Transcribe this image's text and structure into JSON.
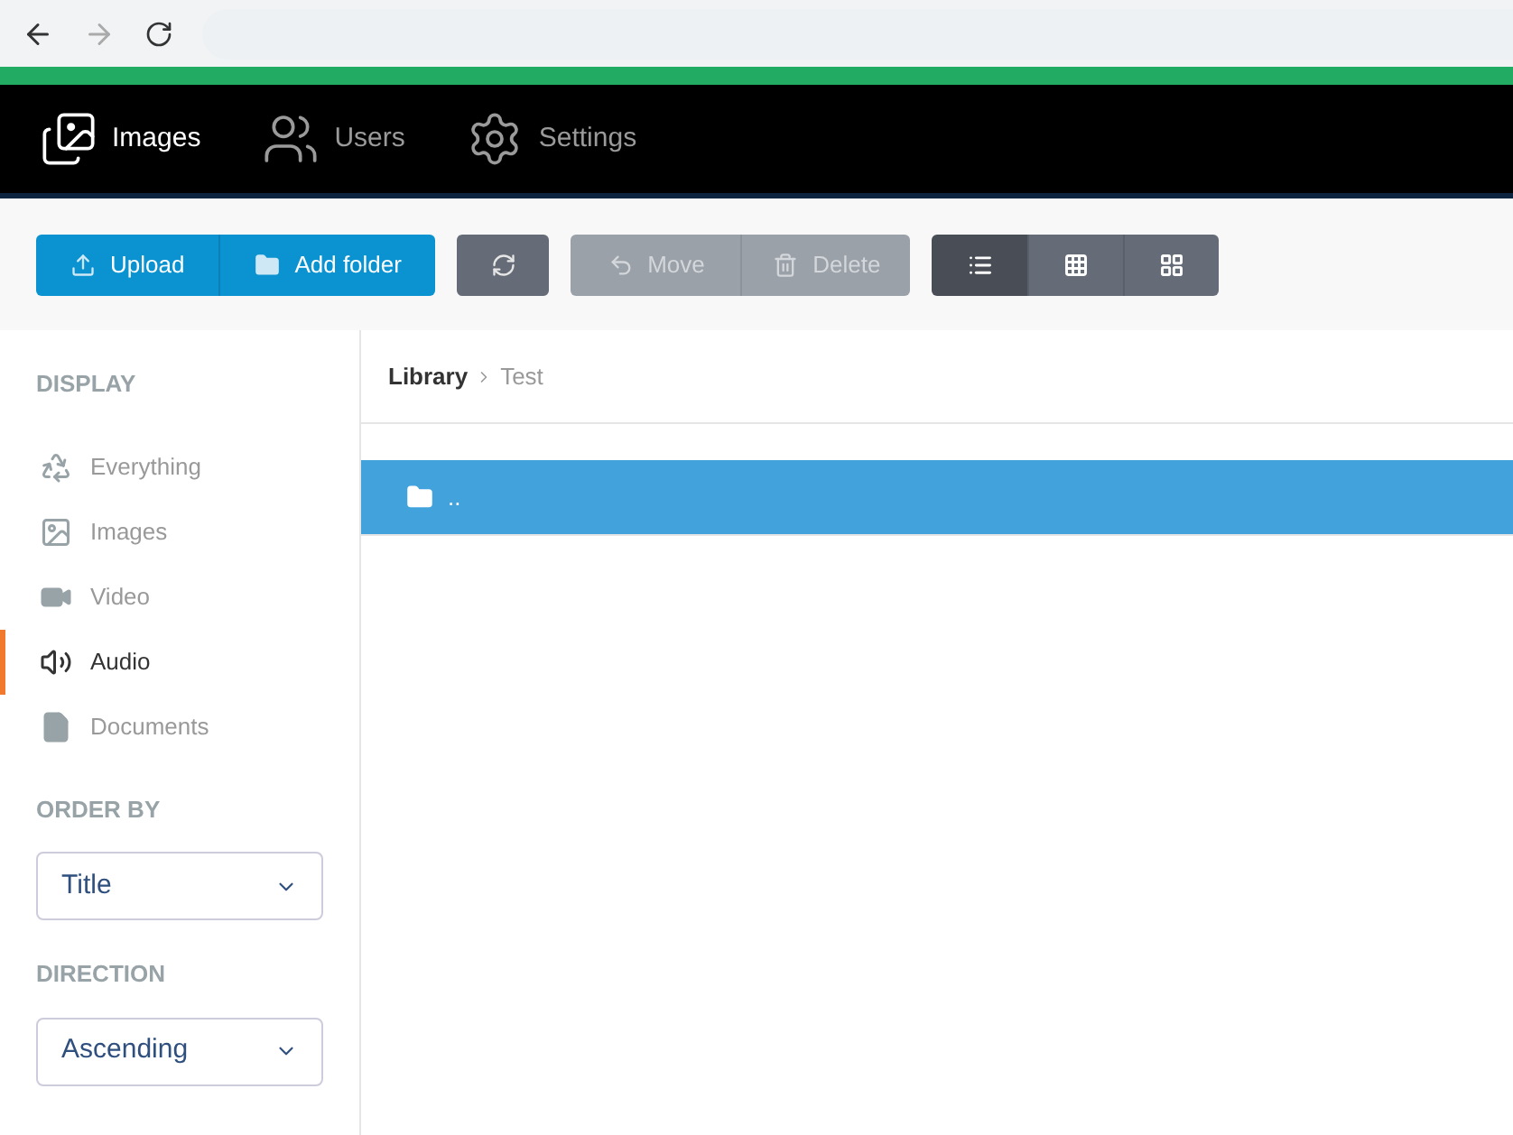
{
  "browser": {
    "back_disabled": false,
    "forward_disabled": true
  },
  "nav": [
    {
      "label": "Images",
      "selected": true
    },
    {
      "label": "Users",
      "selected": false
    },
    {
      "label": "Settings",
      "selected": false
    }
  ],
  "toolbar": {
    "primary": [
      {
        "label": "Upload"
      },
      {
        "label": "Add folder"
      }
    ],
    "refresh": {
      "disabled": false
    },
    "edit": [
      {
        "label": "Move",
        "disabled": true
      },
      {
        "label": "Delete",
        "disabled": true
      }
    ],
    "views": [
      {
        "selected": true
      },
      {
        "selected": false
      },
      {
        "selected": false
      }
    ]
  },
  "sidebar": {
    "display_heading": "DISPLAY",
    "items": [
      {
        "label": "Everything",
        "selected": false
      },
      {
        "label": "Images",
        "selected": false
      },
      {
        "label": "Video",
        "selected": false
      },
      {
        "label": "Audio",
        "selected": true
      },
      {
        "label": "Documents",
        "selected": false
      }
    ],
    "order_heading": "ORDER BY",
    "order_value": "Title",
    "direction_heading": "DIRECTION",
    "direction_value": "Ascending"
  },
  "breadcrumb": [
    {
      "label": "Library",
      "current": false
    },
    {
      "label": "Test",
      "current": true
    }
  ],
  "files": [
    {
      "name": "..",
      "selected": true
    }
  ]
}
